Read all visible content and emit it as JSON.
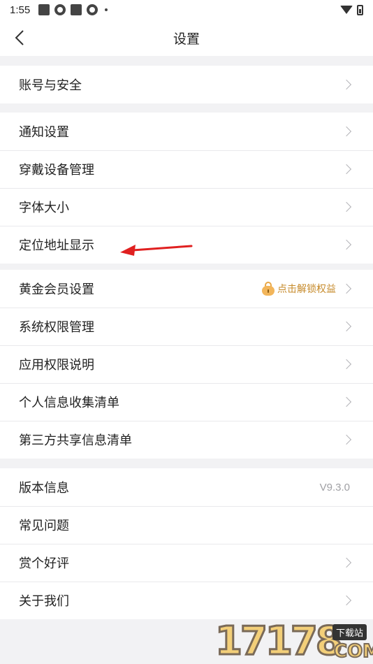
{
  "status_bar": {
    "time": "1:55"
  },
  "header": {
    "title": "设置"
  },
  "groups": [
    {
      "items": [
        {
          "label": "账号与安全"
        }
      ]
    },
    {
      "items": [
        {
          "label": "通知设置"
        },
        {
          "label": "穿戴设备管理"
        },
        {
          "label": "字体大小"
        },
        {
          "label": "定位地址显示"
        }
      ]
    },
    {
      "items": [
        {
          "label": "黄金会员设置",
          "badge": "点击解锁权益"
        },
        {
          "label": "系统权限管理"
        },
        {
          "label": "应用权限说明"
        },
        {
          "label": "个人信息收集清单"
        },
        {
          "label": "第三方共享信息清单"
        }
      ]
    },
    {
      "items": [
        {
          "label": "版本信息",
          "value": "V9.3.0"
        },
        {
          "label": "常见问题"
        },
        {
          "label": "赏个好评"
        },
        {
          "label": "关于我们"
        }
      ]
    }
  ],
  "watermark": {
    "number": "17178",
    "badge": "下载站",
    "suffix": "COM"
  },
  "colors": {
    "background": "#f2f2f4",
    "gold": "#c68a2a",
    "annotation_arrow": "#e02020"
  }
}
